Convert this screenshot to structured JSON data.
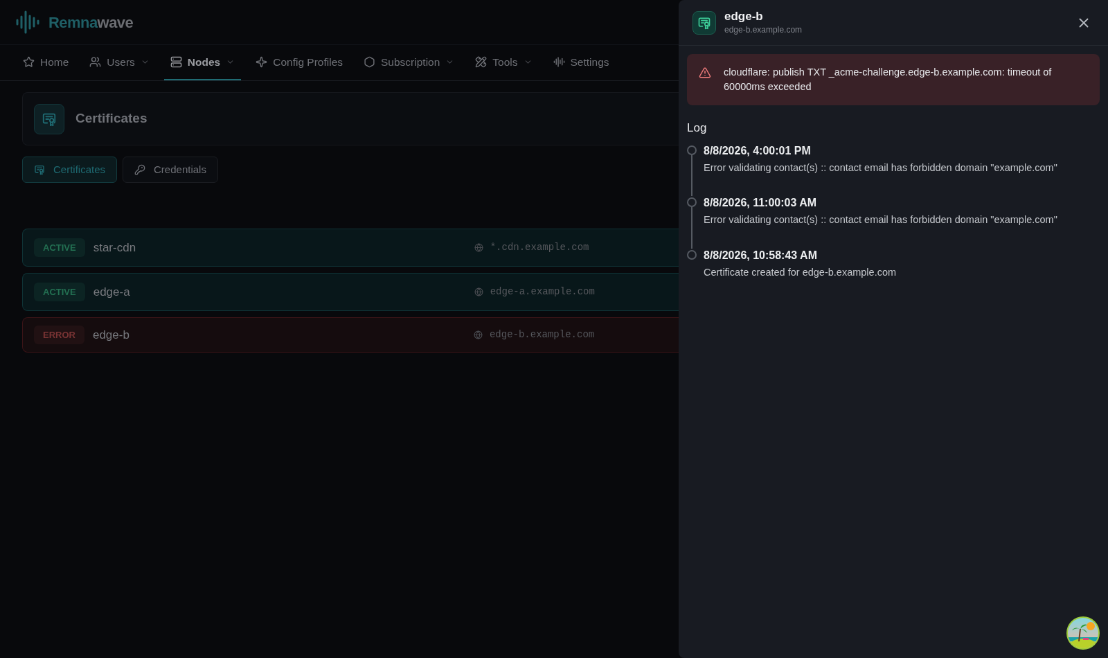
{
  "logo": {
    "primary": "Remna",
    "secondary": "wave"
  },
  "nav": [
    {
      "label": "Home",
      "dropdown": false,
      "selected": false
    },
    {
      "label": "Users",
      "dropdown": true,
      "selected": false
    },
    {
      "label": "Nodes",
      "dropdown": true,
      "selected": true
    },
    {
      "label": "Config Profiles",
      "dropdown": false,
      "selected": false
    },
    {
      "label": "Subscription",
      "dropdown": true,
      "selected": false
    },
    {
      "label": "Tools",
      "dropdown": true,
      "selected": false
    },
    {
      "label": "Settings",
      "dropdown": false,
      "selected": false
    }
  ],
  "page_title": "Certificates",
  "tabs": [
    {
      "label": "Certificates",
      "selected": true
    },
    {
      "label": "Credentials",
      "selected": false
    }
  ],
  "certificates": [
    {
      "status": "ACTIVE",
      "kind": "active",
      "name": "star-cdn",
      "domain": "*.cdn.example.com"
    },
    {
      "status": "ACTIVE",
      "kind": "active",
      "name": "edge-a",
      "domain": "edge-a.example.com"
    },
    {
      "status": "ERROR",
      "kind": "error",
      "name": "edge-b",
      "domain": "edge-b.example.com"
    }
  ],
  "drawer": {
    "title": "edge-b",
    "subtitle": "edge-b.example.com",
    "alert": "cloudflare: publish TXT _acme-challenge.edge-b.example.com: timeout of 60000ms exceeded",
    "log_heading": "Log",
    "log": [
      {
        "time": "8/8/2026, 4:00:01 PM",
        "message": "Error validating contact(s) :: contact email has forbidden domain \"example.com\""
      },
      {
        "time": "8/8/2026, 11:00:03 AM",
        "message": "Error validating contact(s) :: contact email has forbidden domain \"example.com\""
      },
      {
        "time": "8/8/2026, 10:58:43 AM",
        "message": "Certificate created for edge-b.example.com"
      }
    ]
  }
}
